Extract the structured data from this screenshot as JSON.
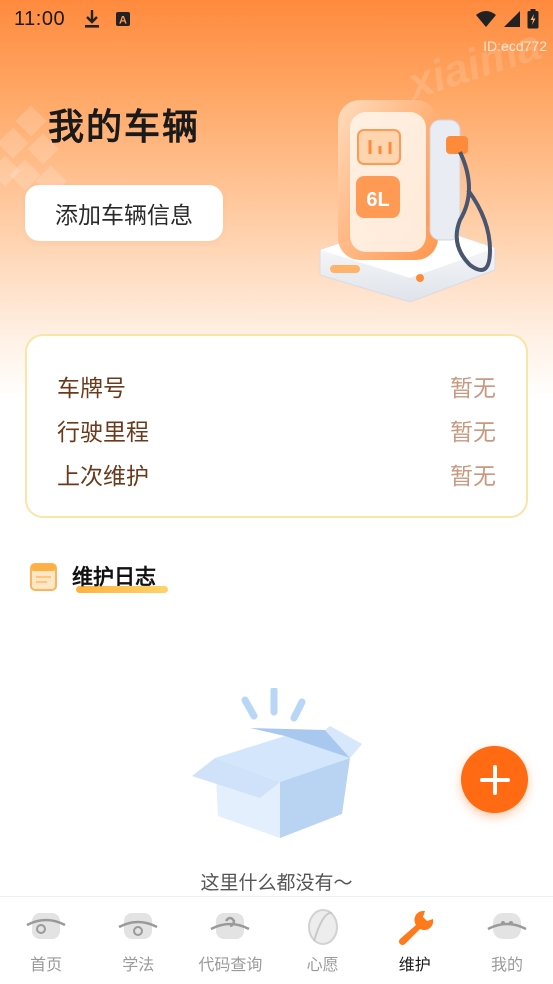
{
  "status_bar": {
    "time": "11:00",
    "icons": [
      "download-icon",
      "a-notification-icon",
      "wifi-icon",
      "signal-icon",
      "battery-icon"
    ]
  },
  "header": {
    "id_text": "ID:ecd772",
    "title": "我的车辆",
    "add_button_label": "添加车辆信息"
  },
  "vehicle_info": {
    "rows": [
      {
        "label": "车牌号",
        "value": "暂无"
      },
      {
        "label": "行驶里程",
        "value": "暂无"
      },
      {
        "label": "上次维护",
        "value": "暂无"
      }
    ]
  },
  "maintenance_log": {
    "title": "维护日志",
    "empty_text": "这里什么都没有～"
  },
  "pump_label": "6L",
  "tabs": [
    {
      "label": "首页",
      "icon": "home-icon"
    },
    {
      "label": "学法",
      "icon": "study-icon"
    },
    {
      "label": "代码查询",
      "icon": "code-query-icon"
    },
    {
      "label": "心愿",
      "icon": "wish-icon"
    },
    {
      "label": "维护",
      "icon": "wrench-icon",
      "active": true
    },
    {
      "label": "我的",
      "icon": "profile-icon"
    }
  ],
  "colors": {
    "accent": "#ff6a13",
    "active_tab": "#ff7a1a",
    "card_border": "#fbe5a6",
    "label": "#6b3a1c",
    "value": "#c79a80"
  }
}
